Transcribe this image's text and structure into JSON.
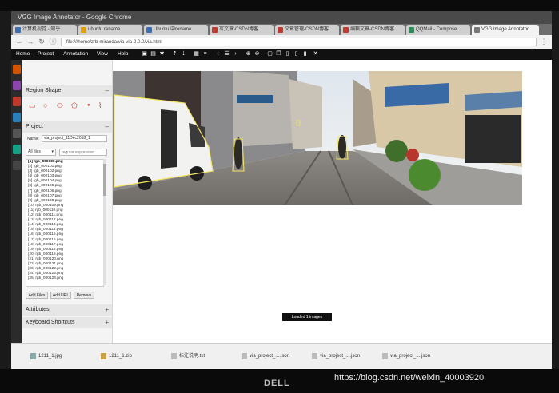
{
  "window": {
    "title": "VGG Image Annotator - Google Chrome"
  },
  "tabs": [
    {
      "label": "计算机视觉 - 知乎",
      "color": "#3b6db3"
    },
    {
      "label": "ubuntu rename",
      "color": "#e0a000"
    },
    {
      "label": "Ubuntu 中rename",
      "color": "#3b6db3"
    },
    {
      "label": "写文章-CSDN博客",
      "color": "#c0392b"
    },
    {
      "label": "文章管理-CSDN博客",
      "color": "#c0392b"
    },
    {
      "label": "编辑文章-CSDN博客",
      "color": "#c0392b"
    },
    {
      "label": "QQMail - Compose",
      "color": "#2e8b57"
    },
    {
      "label": "VGG Image Annotator",
      "color": "#777777"
    }
  ],
  "addressbar": {
    "url": "file:///home/zrb-miranda/via-via-2.0.0/via.html"
  },
  "menu": [
    "Home",
    "Project",
    "Annotation",
    "View",
    "Help"
  ],
  "toolbar_icons": [
    "folder-icon",
    "save-icon",
    "gear-icon",
    "upload-icon",
    "download-icon",
    "grid-icon",
    "list-icon",
    "prev-icon",
    "next-icon",
    "zoom-in-icon",
    "zoom-out-icon",
    "select-icon",
    "copy-icon",
    "paste-icon",
    "paste-icon-2",
    "delete-icon",
    "close-icon"
  ],
  "region_shape": {
    "title": "Region Shape",
    "toggle": "–"
  },
  "project": {
    "title": "Project",
    "toggle": "–",
    "name_label": "Name:",
    "name_value": "via_project_11Dec2018_1",
    "filter_value": "All files",
    "regex_placeholder": "regular expression",
    "files": [
      "[1] rgb_000100.png",
      "[2] rgb_000101.png",
      "[3] rgb_000102.png",
      "[4] rgb_000103.png",
      "[5] rgb_000104.png",
      "[6] rgb_000105.png",
      "[7] rgb_000106.png",
      "[8] rgb_000107.png",
      "[9] rgb_000108.png",
      "[10] rgb_000109.png",
      "[11] rgb_000110.png",
      "[12] rgb_000111.png",
      "[13] rgb_000112.png",
      "[14] rgb_000113.png",
      "[15] rgb_000114.png",
      "[16] rgb_000115.png",
      "[17] rgb_000116.png",
      "[18] rgb_000117.png",
      "[19] rgb_000118.png",
      "[20] rgb_000119.png",
      "[21] rgb_000120.png",
      "[22] rgb_000121.png",
      "[23] rgb_000122.png",
      "[24] rgb_000123.png",
      "[25] rgb_000124.png"
    ],
    "add_files": "Add Files",
    "add_url": "Add URL",
    "remove": "Remove"
  },
  "attributes": {
    "title": "Attributes",
    "toggle": "+"
  },
  "shortcuts": {
    "title": "Keyboard Shortcuts",
    "toggle": "+"
  },
  "status": {
    "message": "Loaded 1 images"
  },
  "taskbar": [
    "1211_1.jpg",
    "1211_1.zip",
    "标注说明.txt",
    "via_project_....json",
    "via_project_....json",
    "via_project_....json"
  ],
  "bezel": {
    "brand": "DELL"
  },
  "watermark": "https://blog.csdn.net/weixin_40003920",
  "colors": {
    "menubar": "#111111",
    "annotation": "#f5e663",
    "accent": "#c0392b"
  }
}
